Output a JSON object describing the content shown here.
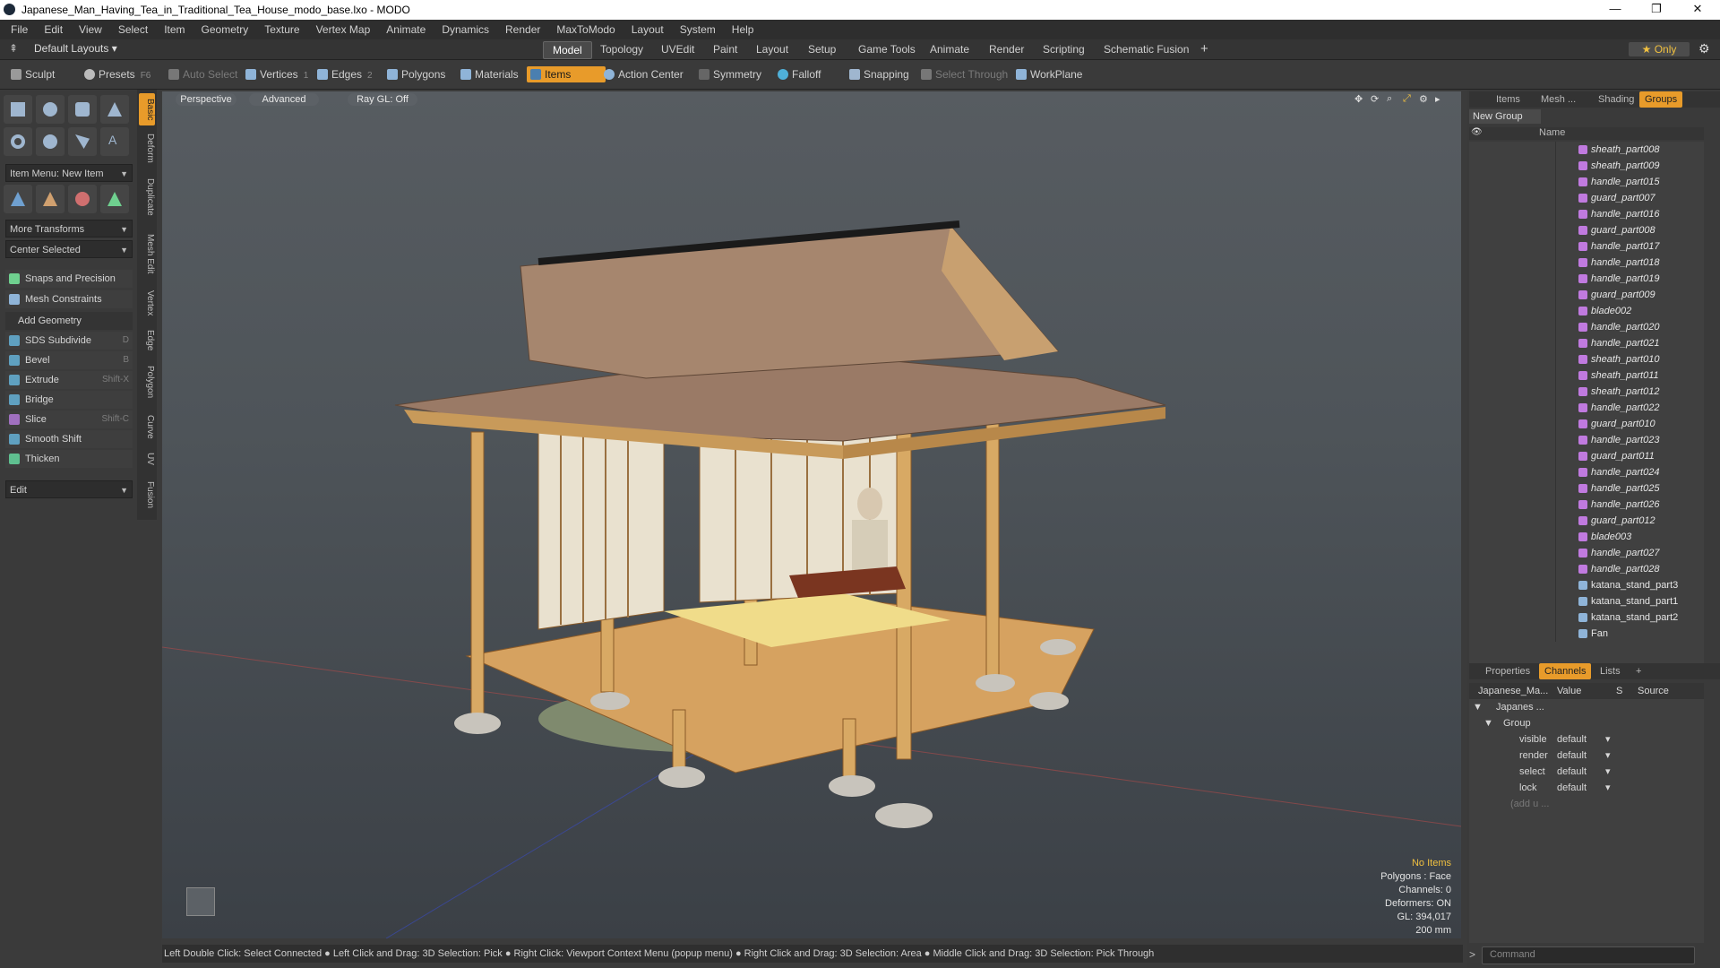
{
  "window": {
    "title": "Japanese_Man_Having_Tea_in_Traditional_Tea_House_modo_base.lxo - MODO",
    "controls": [
      "—",
      "❐",
      "✕"
    ]
  },
  "menu": [
    "File",
    "Edit",
    "View",
    "Select",
    "Item",
    "Geometry",
    "Texture",
    "Vertex Map",
    "Animate",
    "Dynamics",
    "Render",
    "MaxToModo",
    "Layout",
    "System",
    "Help"
  ],
  "layout_bar": {
    "layout_select": "Default Layouts ▾",
    "tabs": [
      "Model",
      "Topology",
      "UVEdit",
      "Paint",
      "Layout",
      "Setup",
      "Game Tools",
      "Animate",
      "Render",
      "Scripting",
      "Schematic Fusion",
      "+"
    ],
    "active_tab": "Model",
    "only_label": "★ Only"
  },
  "toolbar": {
    "sculpt": "Sculpt",
    "presets": "Presets",
    "presets_key": "F6",
    "auto_select": "Auto Select",
    "vertices": "Vertices",
    "vertices_count": "1",
    "edges": "Edges",
    "edges_count": "2",
    "polygons": "Polygons",
    "materials": "Materials",
    "items": "Items",
    "action_center": "Action Center",
    "symmetry": "Symmetry",
    "falloff": "Falloff",
    "snapping": "Snapping",
    "select_through": "Select Through",
    "workplane": "WorkPlane"
  },
  "left_panel": {
    "vertical_tabs": [
      "Basic",
      "Deform",
      "Duplicate",
      "Mesh Edit",
      "Vertex",
      "Edge",
      "Polygon",
      "Curve",
      "UV",
      "Fusion"
    ],
    "item_menu": "Item Menu: New Item",
    "more_transforms": "More Transforms",
    "center_selected": "Center Selected",
    "snaps": "Snaps and Precision",
    "mesh_constraints": "Mesh Constraints",
    "add_geometry": "Add Geometry",
    "tools": [
      {
        "label": "SDS Subdivide",
        "key": "D"
      },
      {
        "label": "Bevel",
        "key": "B"
      },
      {
        "label": "Extrude",
        "key": "Shift-X"
      },
      {
        "label": "Bridge",
        "key": ""
      },
      {
        "label": "Slice",
        "key": "Shift-C"
      },
      {
        "label": "Smooth Shift",
        "key": ""
      },
      {
        "label": "Thicken",
        "key": ""
      }
    ],
    "edit": "Edit"
  },
  "viewport": {
    "tabs": [
      "Perspective",
      "Advanced",
      "Ray GL: Off"
    ],
    "info": {
      "no_items": "No Items",
      "polygons": "Polygons : Face",
      "channels": "Channels: 0",
      "deformers": "Deformers: ON",
      "gl": "GL: 394,017",
      "scale": "200 mm"
    }
  },
  "status_bar": "Left Double Click: Select Connected ● Left Click and Drag: 3D Selection: Pick ● Right Click: Viewport Context Menu (popup menu) ● Right Click and Drag: 3D Selection: Area ● Middle Click and Drag: 3D Selection: Pick Through",
  "right_panel": {
    "tabs": [
      "Items",
      "Mesh ...",
      "Shading",
      "Groups"
    ],
    "active_tab": "Groups",
    "new_group": "New Group",
    "name_header": "Name",
    "groups": [
      "sheath_part008",
      "sheath_part009",
      "handle_part015",
      "guard_part007",
      "handle_part016",
      "guard_part008",
      "handle_part017",
      "handle_part018",
      "handle_part019",
      "guard_part009",
      "blade002",
      "handle_part020",
      "handle_part021",
      "sheath_part010",
      "sheath_part011",
      "sheath_part012",
      "handle_part022",
      "guard_part010",
      "handle_part023",
      "guard_part011",
      "handle_part024",
      "handle_part025",
      "handle_part026",
      "guard_part012",
      "blade003",
      "handle_part027",
      "handle_part028",
      "katana_stand_part3",
      "katana_stand_part1",
      "katana_stand_part2",
      "Fan"
    ],
    "bottom_tabs": [
      "Properties",
      "Channels",
      "Lists",
      "+"
    ],
    "bottom_active": "Channels",
    "channel_headers": [
      "Japanese_Ma...",
      "Value",
      "S",
      "Source"
    ],
    "channel_tree": [
      "Japanes ...",
      "Group"
    ],
    "channels": [
      {
        "name": "visible",
        "value": "default"
      },
      {
        "name": "render",
        "value": "default"
      },
      {
        "name": "select",
        "value": "default"
      },
      {
        "name": "lock",
        "value": "default"
      }
    ],
    "add_user": "(add u ...",
    "command_placeholder": "Command"
  }
}
